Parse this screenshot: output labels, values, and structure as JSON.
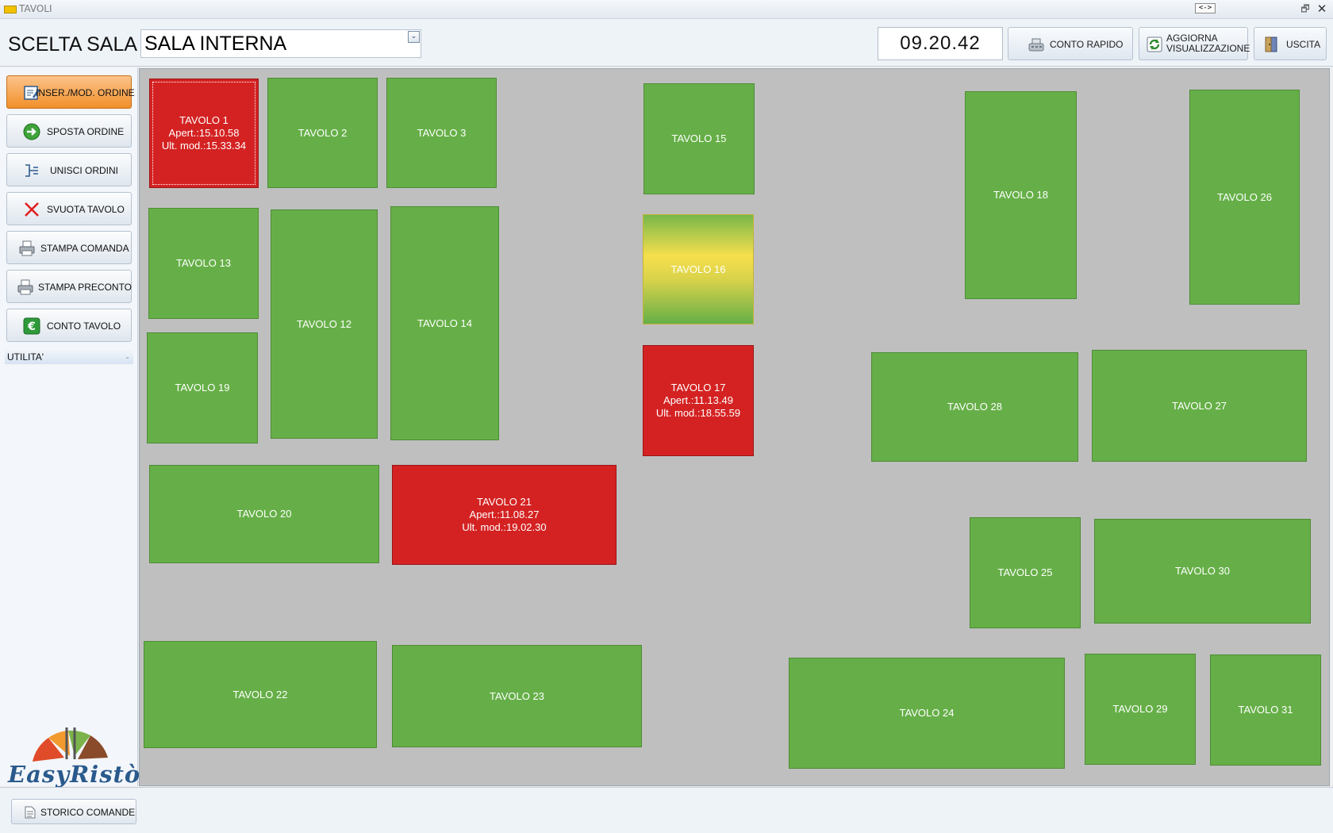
{
  "window": {
    "title": "TAVOLI",
    "resize_glyph": "<->",
    "restore_glyph": "🗗",
    "close_glyph": "✕"
  },
  "header": {
    "room_label": "SCELTA SALA",
    "room_selected": "SALA INTERNA",
    "dropdown_glyph": "⌄",
    "clock": "09.20.42",
    "buttons": {
      "quick_bill": "CONTO RAPIDO",
      "refresh_line1": "AGGIORNA",
      "refresh_line2": "VISUALIZZAZIONE",
      "exit": "USCITA"
    }
  },
  "sidebar": {
    "items": [
      {
        "label": "INSER./MOD. ORDINE",
        "icon": "edit-order-icon"
      },
      {
        "label": "SPOSTA ORDINE",
        "icon": "move-arrow-icon"
      },
      {
        "label": "UNISCI ORDINI",
        "icon": "merge-icon"
      },
      {
        "label": "SVUOTA TAVOLO",
        "icon": "clear-x-icon"
      },
      {
        "label": "STAMPA COMANDA",
        "icon": "printer-icon"
      },
      {
        "label": "STAMPA PRECONTO",
        "icon": "printer-icon"
      },
      {
        "label": "CONTO TAVOLO",
        "icon": "euro-icon"
      }
    ],
    "utility_label": "UTILITA'",
    "utility_glyph": "⌄",
    "logo_text": "EasyRistò"
  },
  "tables": [
    {
      "name": "TAVOLO 1",
      "status": "busy",
      "open": "Apert.:15.10.58",
      "modified": "Ult. mod.:15.33.34"
    },
    {
      "name": "TAVOLO 2",
      "status": "free"
    },
    {
      "name": "TAVOLO 3",
      "status": "free"
    },
    {
      "name": "TAVOLO 15",
      "status": "free"
    },
    {
      "name": "TAVOLO 18",
      "status": "free"
    },
    {
      "name": "TAVOLO 26",
      "status": "free"
    },
    {
      "name": "TAVOLO 13",
      "status": "free"
    },
    {
      "name": "TAVOLO 12",
      "status": "free"
    },
    {
      "name": "TAVOLO 14",
      "status": "free"
    },
    {
      "name": "TAVOLO 16",
      "status": "pending"
    },
    {
      "name": "TAVOLO 19",
      "status": "free"
    },
    {
      "name": "TAVOLO 17",
      "status": "busy",
      "open": "Apert.:11.13.49",
      "modified": "Ult. mod.:18.55.59"
    },
    {
      "name": "TAVOLO 28",
      "status": "free"
    },
    {
      "name": "TAVOLO 27",
      "status": "free"
    },
    {
      "name": "TAVOLO 20",
      "status": "free"
    },
    {
      "name": "TAVOLO 21",
      "status": "busy",
      "open": "Apert.:11.08.27",
      "modified": "Ult. mod.:19.02.30"
    },
    {
      "name": "TAVOLO 25",
      "status": "free"
    },
    {
      "name": "TAVOLO 30",
      "status": "free"
    },
    {
      "name": "TAVOLO 22",
      "status": "free"
    },
    {
      "name": "TAVOLO 23",
      "status": "free"
    },
    {
      "name": "TAVOLO 24",
      "status": "free"
    },
    {
      "name": "TAVOLO 29",
      "status": "free"
    },
    {
      "name": "TAVOLO 31",
      "status": "free"
    }
  ],
  "footer": {
    "history_button": "STORICO COMANDE"
  },
  "colors": {
    "free": "#66af48",
    "busy": "#d42222",
    "pending": "#f7df4d",
    "active_button": "#f18f2a"
  }
}
